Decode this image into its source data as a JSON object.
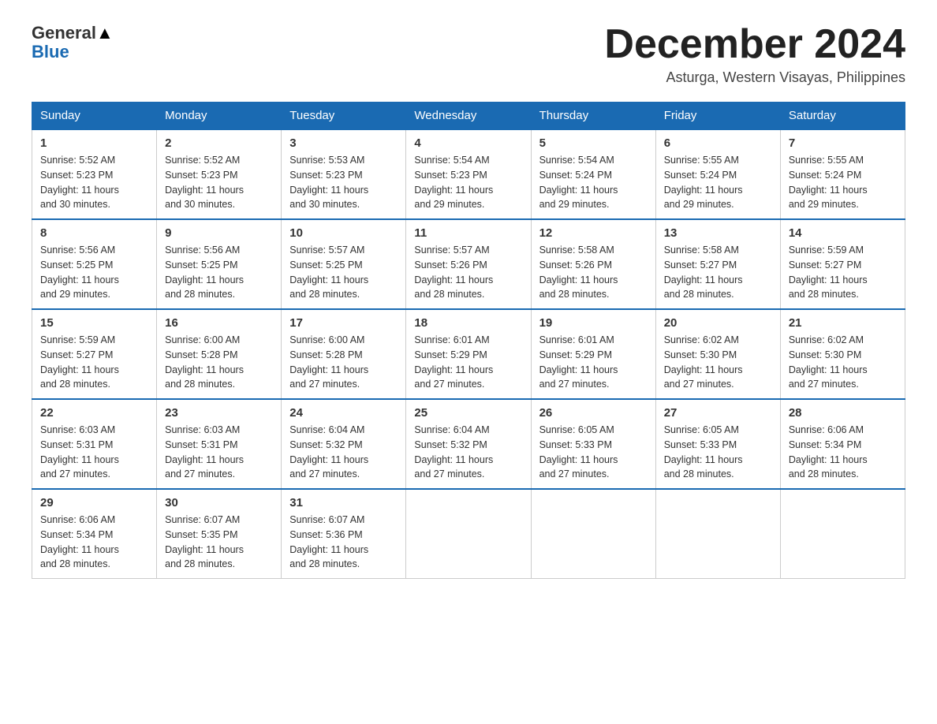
{
  "header": {
    "logo_line1": "General",
    "logo_line2": "Blue",
    "month_title": "December 2024",
    "location": "Asturga, Western Visayas, Philippines"
  },
  "days_of_week": [
    "Sunday",
    "Monday",
    "Tuesday",
    "Wednesday",
    "Thursday",
    "Friday",
    "Saturday"
  ],
  "weeks": [
    [
      {
        "day": "1",
        "sunrise": "5:52 AM",
        "sunset": "5:23 PM",
        "daylight": "11 hours and 30 minutes."
      },
      {
        "day": "2",
        "sunrise": "5:52 AM",
        "sunset": "5:23 PM",
        "daylight": "11 hours and 30 minutes."
      },
      {
        "day": "3",
        "sunrise": "5:53 AM",
        "sunset": "5:23 PM",
        "daylight": "11 hours and 30 minutes."
      },
      {
        "day": "4",
        "sunrise": "5:54 AM",
        "sunset": "5:23 PM",
        "daylight": "11 hours and 29 minutes."
      },
      {
        "day": "5",
        "sunrise": "5:54 AM",
        "sunset": "5:24 PM",
        "daylight": "11 hours and 29 minutes."
      },
      {
        "day": "6",
        "sunrise": "5:55 AM",
        "sunset": "5:24 PM",
        "daylight": "11 hours and 29 minutes."
      },
      {
        "day": "7",
        "sunrise": "5:55 AM",
        "sunset": "5:24 PM",
        "daylight": "11 hours and 29 minutes."
      }
    ],
    [
      {
        "day": "8",
        "sunrise": "5:56 AM",
        "sunset": "5:25 PM",
        "daylight": "11 hours and 29 minutes."
      },
      {
        "day": "9",
        "sunrise": "5:56 AM",
        "sunset": "5:25 PM",
        "daylight": "11 hours and 28 minutes."
      },
      {
        "day": "10",
        "sunrise": "5:57 AM",
        "sunset": "5:25 PM",
        "daylight": "11 hours and 28 minutes."
      },
      {
        "day": "11",
        "sunrise": "5:57 AM",
        "sunset": "5:26 PM",
        "daylight": "11 hours and 28 minutes."
      },
      {
        "day": "12",
        "sunrise": "5:58 AM",
        "sunset": "5:26 PM",
        "daylight": "11 hours and 28 minutes."
      },
      {
        "day": "13",
        "sunrise": "5:58 AM",
        "sunset": "5:27 PM",
        "daylight": "11 hours and 28 minutes."
      },
      {
        "day": "14",
        "sunrise": "5:59 AM",
        "sunset": "5:27 PM",
        "daylight": "11 hours and 28 minutes."
      }
    ],
    [
      {
        "day": "15",
        "sunrise": "5:59 AM",
        "sunset": "5:27 PM",
        "daylight": "11 hours and 28 minutes."
      },
      {
        "day": "16",
        "sunrise": "6:00 AM",
        "sunset": "5:28 PM",
        "daylight": "11 hours and 28 minutes."
      },
      {
        "day": "17",
        "sunrise": "6:00 AM",
        "sunset": "5:28 PM",
        "daylight": "11 hours and 27 minutes."
      },
      {
        "day": "18",
        "sunrise": "6:01 AM",
        "sunset": "5:29 PM",
        "daylight": "11 hours and 27 minutes."
      },
      {
        "day": "19",
        "sunrise": "6:01 AM",
        "sunset": "5:29 PM",
        "daylight": "11 hours and 27 minutes."
      },
      {
        "day": "20",
        "sunrise": "6:02 AM",
        "sunset": "5:30 PM",
        "daylight": "11 hours and 27 minutes."
      },
      {
        "day": "21",
        "sunrise": "6:02 AM",
        "sunset": "5:30 PM",
        "daylight": "11 hours and 27 minutes."
      }
    ],
    [
      {
        "day": "22",
        "sunrise": "6:03 AM",
        "sunset": "5:31 PM",
        "daylight": "11 hours and 27 minutes."
      },
      {
        "day": "23",
        "sunrise": "6:03 AM",
        "sunset": "5:31 PM",
        "daylight": "11 hours and 27 minutes."
      },
      {
        "day": "24",
        "sunrise": "6:04 AM",
        "sunset": "5:32 PM",
        "daylight": "11 hours and 27 minutes."
      },
      {
        "day": "25",
        "sunrise": "6:04 AM",
        "sunset": "5:32 PM",
        "daylight": "11 hours and 27 minutes."
      },
      {
        "day": "26",
        "sunrise": "6:05 AM",
        "sunset": "5:33 PM",
        "daylight": "11 hours and 27 minutes."
      },
      {
        "day": "27",
        "sunrise": "6:05 AM",
        "sunset": "5:33 PM",
        "daylight": "11 hours and 28 minutes."
      },
      {
        "day": "28",
        "sunrise": "6:06 AM",
        "sunset": "5:34 PM",
        "daylight": "11 hours and 28 minutes."
      }
    ],
    [
      {
        "day": "29",
        "sunrise": "6:06 AM",
        "sunset": "5:34 PM",
        "daylight": "11 hours and 28 minutes."
      },
      {
        "day": "30",
        "sunrise": "6:07 AM",
        "sunset": "5:35 PM",
        "daylight": "11 hours and 28 minutes."
      },
      {
        "day": "31",
        "sunrise": "6:07 AM",
        "sunset": "5:36 PM",
        "daylight": "11 hours and 28 minutes."
      },
      null,
      null,
      null,
      null
    ]
  ],
  "labels": {
    "sunrise": "Sunrise:",
    "sunset": "Sunset:",
    "daylight": "Daylight:"
  }
}
